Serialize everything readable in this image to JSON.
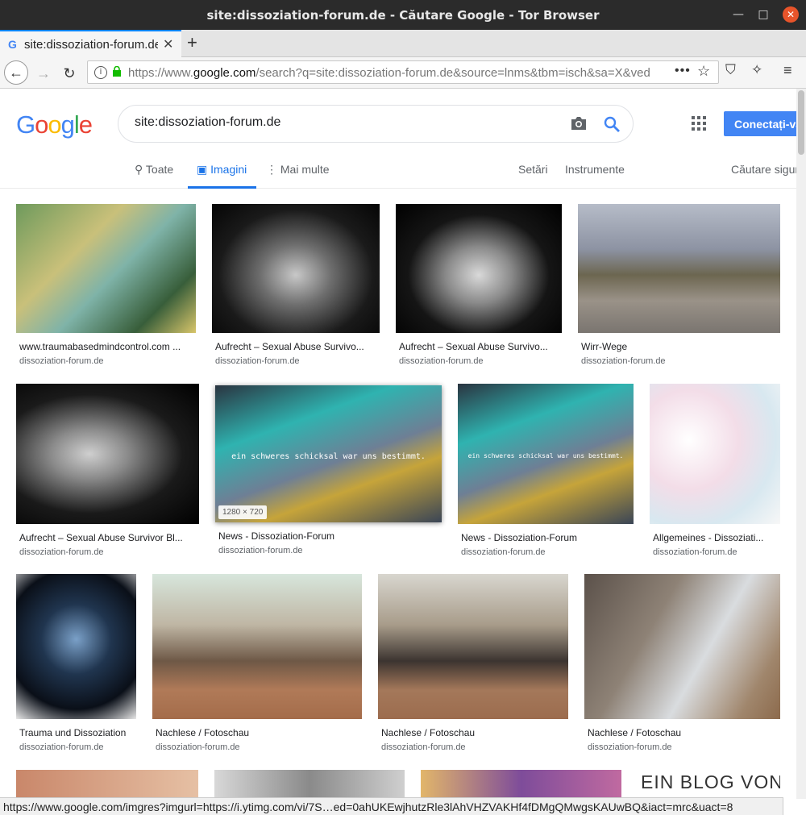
{
  "window": {
    "title": "site:dissoziation-forum.de - Căutare Google - Tor Browser"
  },
  "tab": {
    "title": "site:dissoziation-forum.de"
  },
  "address": {
    "prefix": "https://www.",
    "domain": "google.com",
    "rest": "/search?q=site:dissoziation-forum.de&source=lnms&tbm=isch&sa=X&ved"
  },
  "google": {
    "logo": [
      "G",
      "o",
      "o",
      "g",
      "l",
      "e"
    ],
    "logo_colors": [
      "#4285f4",
      "#ea4335",
      "#fbbc05",
      "#4285f4",
      "#34a853",
      "#ea4335"
    ],
    "query": "site:dissoziation-forum.de",
    "signin_label": "Conectați-vă",
    "tabs": {
      "all": "Toate",
      "images": "Imagini",
      "more": "Mai multe",
      "settings": "Setări",
      "tools": "Instrumente",
      "safe": "Căutare sigură"
    }
  },
  "results": [
    {
      "caption": "www.traumabasedmindcontrol.com ...",
      "source": "dissoziation-forum.de"
    },
    {
      "caption": "Aufrecht – Sexual Abuse Survivo...",
      "source": "dissoziation-forum.de"
    },
    {
      "caption": "Aufrecht – Sexual Abuse Survivo...",
      "source": "dissoziation-forum.de"
    },
    {
      "caption": "Wirr-Wege",
      "source": "dissoziation-forum.de"
    },
    {
      "caption": "Aufrecht – Sexual Abuse Survivor Bl...",
      "source": "dissoziation-forum.de"
    },
    {
      "caption": "News - Dissoziation-Forum",
      "source": "dissoziation-forum.de",
      "badge": "1280 × 720",
      "overlay": "ein schweres schicksal war uns bestimmt."
    },
    {
      "caption": "News - Dissoziation-Forum",
      "source": "dissoziation-forum.de",
      "overlay": "ein schweres schicksal war uns bestimmt."
    },
    {
      "caption": "Allgemeines - Dissoziati...",
      "source": "dissoziation-forum.de"
    },
    {
      "caption": "Trauma und Dissoziation",
      "source": "dissoziation-forum.de"
    },
    {
      "caption": "Nachlese / Fotoschau",
      "source": "dissoziation-forum.de"
    },
    {
      "caption": "Nachlese / Fotoschau",
      "source": "dissoziation-forum.de"
    },
    {
      "caption": "Nachlese / Fotoschau",
      "source": "dissoziation-forum.de"
    },
    {
      "overlay": "EIN BLOG VON"
    }
  ],
  "status": {
    "url": "https://www.google.com/imgres?imgurl=https://i.ytimg.com/vi/7S…ed=0ahUKEwjhutzRle3lAhVHZVAKHf4fDMgQMwgsKAUwBQ&iact=mrc&uact=8"
  }
}
